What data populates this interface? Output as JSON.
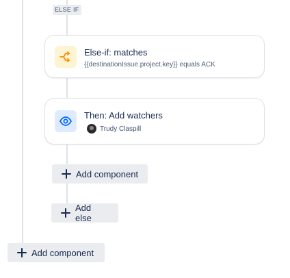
{
  "branch_tag": "ELSE IF",
  "else_if_card": {
    "title": "Else-if: matches",
    "condition": "{{destinationIssue.project.key}} equals ACK",
    "icon": "branch-icon",
    "icon_color": "#ff8b00"
  },
  "then_card": {
    "title": "Then: Add watchers",
    "watcher_name": "Trudy Claspill",
    "icon": "eye-icon",
    "icon_color": "#0065ff"
  },
  "buttons": {
    "add_component_inner": "Add component",
    "add_else": "Add else",
    "add_component_outer": "Add component"
  },
  "colors": {
    "connector": "#dfe1e6",
    "button_bg": "#ebecf0",
    "text": "#172b4d"
  }
}
